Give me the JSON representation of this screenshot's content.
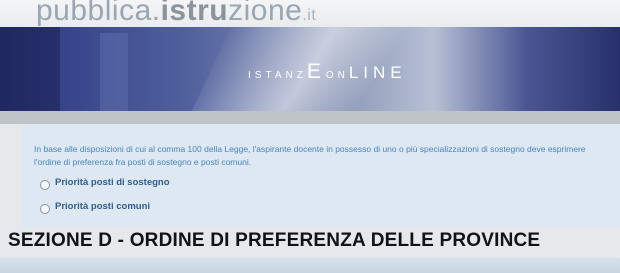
{
  "header": {
    "logo_part1": "pubblica.",
    "logo_part2": "istru",
    "logo_part3": "zione",
    "logo_tld": ".it"
  },
  "banner": {
    "brand_part1": "ISTANZ",
    "brand_part2": "E",
    "brand_part3": "ON",
    "brand_part4": "LINE"
  },
  "info_panel": {
    "text": "In base alle disposizioni di cui al comma 100 della Legge, l'aspirante docente in possesso di uno o più specializzazioni di sostegno deve esprimere l'ordine di preferenza fra posti di sostegno e posti comuni.",
    "options": [
      {
        "label": "Priorità posti di sostegno",
        "selected": false
      },
      {
        "label": "Priorità posti comuni",
        "selected": false
      }
    ]
  },
  "section": {
    "title": "SEZIONE D - ORDINE DI PREFERENZA DELLE PROVINCE"
  },
  "colors": {
    "banner_dark": "#2b3576",
    "panel_bg": "#dde8f2",
    "info_text": "#4a86b7",
    "option_text": "#2f5e8a"
  }
}
